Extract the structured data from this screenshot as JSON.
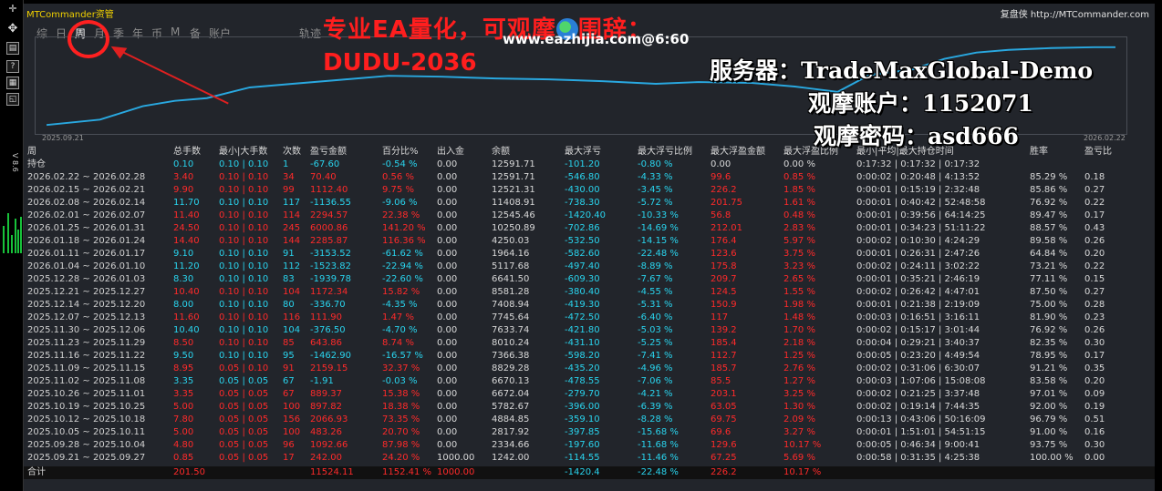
{
  "window": {
    "title": "MTCommander资管",
    "brand": "复盘侠 http://MTCommander.com"
  },
  "toolbar_icons": [
    "move-icon",
    "document-icon",
    "help-icon",
    "grid-icon",
    "window-icon"
  ],
  "side_label": "V 8.6",
  "tabs": [
    "综",
    "日",
    "周",
    "月",
    "季",
    "年",
    "币",
    "M",
    "备",
    "账户"
  ],
  "active_tab": "周",
  "track_tab": "轨迹",
  "chart": {
    "start_date": "2025.09.21",
    "end_date": "2026.02.22",
    "line_color": "#29a8e0"
  },
  "overlay": {
    "title": "专业EA量化，可观摩",
    "title_suffix": "围辞：",
    "code": "DUDU-2036",
    "site": "www.eazhijia.com@6:60",
    "server": "服务器：TradeMaxGlobal-Demo",
    "account": "观摩账户：1152071",
    "password": "观摩密码：asd666"
  },
  "headers": [
    "周",
    "总手数",
    "最小|大手数",
    "次数",
    "盈亏金额",
    "百分比%",
    "出入金",
    "余额",
    "最大浮亏",
    "最大浮亏比例",
    "最大浮盈金额",
    "最大浮盈比例",
    "最小|平均|最大持仓时间",
    "胜率",
    "盈亏比"
  ],
  "holding": {
    "period": "持仓",
    "lots": "0.10",
    "minmax": "0.10 | 0.10",
    "count": "1",
    "pnl": "-67.60",
    "pct": "-0.54 %",
    "io": "0.00",
    "balance": "12591.71",
    "maxdd": "-101.20",
    "maxdd_pct": "-0.80 %",
    "maxfp": "0.00",
    "maxfp_pct": "0.00 %",
    "time": "0:17:32 | 0:17:32 | 0:17:32",
    "winrate": "",
    "pf": ""
  },
  "rows": [
    [
      "2026.02.22 ~ 2026.02.28",
      "3.40",
      "0.10 | 0.10",
      "34",
      "70.40",
      "0.56 %",
      "0.00",
      "12591.71",
      "-546.80",
      "-4.33 %",
      "99.6",
      "0.85 %",
      "0:00:02 | 0:20:48 | 4:13:52",
      "85.29 %",
      "0.18"
    ],
    [
      "2026.02.15 ~ 2026.02.21",
      "9.90",
      "0.10 | 0.10",
      "99",
      "1112.40",
      "9.75 %",
      "0.00",
      "12521.31",
      "-430.00",
      "-3.45 %",
      "226.2",
      "1.85 %",
      "0:00:01 | 0:15:19 | 2:32:48",
      "85.86 %",
      "0.27"
    ],
    [
      "2026.02.08 ~ 2026.02.14",
      "11.70",
      "0.10 | 0.10",
      "117",
      "-1136.55",
      "-9.06 %",
      "0.00",
      "11408.91",
      "-738.30",
      "-5.72 %",
      "201.75",
      "1.61 %",
      "0:00:01 | 0:40:42 | 52:48:58",
      "76.92 %",
      "0.22"
    ],
    [
      "2026.02.01 ~ 2026.02.07",
      "11.40",
      "0.10 | 0.10",
      "114",
      "2294.57",
      "22.38 %",
      "0.00",
      "12545.46",
      "-1420.40",
      "-10.33 %",
      "56.8",
      "0.48 %",
      "0:00:01 | 0:39:56 | 64:14:25",
      "89.47 %",
      "0.17"
    ],
    [
      "2026.01.25 ~ 2026.01.31",
      "24.50",
      "0.10 | 0.10",
      "245",
      "6000.86",
      "141.20 %",
      "0.00",
      "10250.89",
      "-702.86",
      "-14.69 %",
      "212.01",
      "2.83 %",
      "0:00:01 | 0:34:23 | 51:11:22",
      "88.57 %",
      "0.43"
    ],
    [
      "2026.01.18 ~ 2026.01.24",
      "14.40",
      "0.10 | 0.10",
      "144",
      "2285.87",
      "116.36 %",
      "0.00",
      "4250.03",
      "-532.50",
      "-14.15 %",
      "176.4",
      "5.97 %",
      "0:00:02 | 0:10:30 | 4:24:29",
      "89.58 %",
      "0.26"
    ],
    [
      "2026.01.11 ~ 2026.01.17",
      "9.10",
      "0.10 | 0.10",
      "91",
      "-3153.52",
      "-61.62 %",
      "0.00",
      "1964.16",
      "-582.60",
      "-22.48 %",
      "123.6",
      "3.75 %",
      "0:00:01 | 0:26:31 | 2:47:26",
      "64.84 %",
      "0.20"
    ],
    [
      "2026.01.04 ~ 2026.01.10",
      "11.20",
      "0.10 | 0.10",
      "112",
      "-1523.82",
      "-22.94 %",
      "0.00",
      "5117.68",
      "-497.40",
      "-8.89 %",
      "175.8",
      "3.23 %",
      "0:00:02 | 0:24:11 | 3:02:22",
      "73.21 %",
      "0.22"
    ],
    [
      "2025.12.28 ~ 2026.01.03",
      "8.30",
      "0.10 | 0.10",
      "83",
      "-1939.78",
      "-22.60 %",
      "0.00",
      "6641.50",
      "-609.30",
      "-7.67 %",
      "209.7",
      "2.65 %",
      "0:00:01 | 0:35:21 | 2:46:19",
      "77.11 %",
      "0.15"
    ],
    [
      "2025.12.21 ~ 2025.12.27",
      "10.40",
      "0.10 | 0.10",
      "104",
      "1172.34",
      "15.82 %",
      "0.00",
      "8581.28",
      "-380.40",
      "-4.55 %",
      "124.5",
      "1.55 %",
      "0:00:02 | 0:26:42 | 4:47:01",
      "87.50 %",
      "0.27"
    ],
    [
      "2025.12.14 ~ 2025.12.20",
      "8.00",
      "0.10 | 0.10",
      "80",
      "-336.70",
      "-4.35 %",
      "0.00",
      "7408.94",
      "-419.30",
      "-5.31 %",
      "150.9",
      "1.98 %",
      "0:00:01 | 0:21:38 | 2:19:09",
      "75.00 %",
      "0.28"
    ],
    [
      "2025.12.07 ~ 2025.12.13",
      "11.60",
      "0.10 | 0.10",
      "116",
      "111.90",
      "1.47 %",
      "0.00",
      "7745.64",
      "-472.50",
      "-6.40 %",
      "117",
      "1.48 %",
      "0:00:03 | 0:16:51 | 3:16:11",
      "81.90 %",
      "0.23"
    ],
    [
      "2025.11.30 ~ 2025.12.06",
      "10.40",
      "0.10 | 0.10",
      "104",
      "-376.50",
      "-4.70 %",
      "0.00",
      "7633.74",
      "-421.80",
      "-5.03 %",
      "139.2",
      "1.70 %",
      "0:00:02 | 0:15:17 | 3:01:44",
      "76.92 %",
      "0.26"
    ],
    [
      "2025.11.23 ~ 2025.11.29",
      "8.50",
      "0.10 | 0.10",
      "85",
      "643.86",
      "8.74 %",
      "0.00",
      "8010.24",
      "-431.10",
      "-5.25 %",
      "185.4",
      "2.18 %",
      "0:00:04 | 0:29:21 | 3:40:37",
      "82.35 %",
      "0.30"
    ],
    [
      "2025.11.16 ~ 2025.11.22",
      "9.50",
      "0.10 | 0.10",
      "95",
      "-1462.90",
      "-16.57 %",
      "0.00",
      "7366.38",
      "-598.20",
      "-7.41 %",
      "112.7",
      "1.25 %",
      "0:00:05 | 0:23:20 | 4:49:54",
      "78.95 %",
      "0.17"
    ],
    [
      "2025.11.09 ~ 2025.11.15",
      "8.95",
      "0.05 | 0.10",
      "91",
      "2159.15",
      "32.37 %",
      "0.00",
      "8829.28",
      "-435.20",
      "-4.96 %",
      "185.7",
      "2.76 %",
      "0:00:02 | 0:31:06 | 6:30:07",
      "91.21 %",
      "0.35"
    ],
    [
      "2025.11.02 ~ 2025.11.08",
      "3.35",
      "0.05 | 0.05",
      "67",
      "-1.91",
      "-0.03 %",
      "0.00",
      "6670.13",
      "-478.55",
      "-7.06 %",
      "85.5",
      "1.27 %",
      "0:00:03 | 1:07:06 | 15:08:08",
      "83.58 %",
      "0.20"
    ],
    [
      "2025.10.26 ~ 2025.11.01",
      "3.35",
      "0.05 | 0.05",
      "67",
      "889.37",
      "15.38 %",
      "0.00",
      "6672.04",
      "-279.70",
      "-4.21 %",
      "203.1",
      "3.25 %",
      "0:00:02 | 0:21:25 | 3:37:48",
      "97.01 %",
      "0.09"
    ],
    [
      "2025.10.19 ~ 2025.10.25",
      "5.00",
      "0.05 | 0.05",
      "100",
      "897.82",
      "18.38 %",
      "0.00",
      "5782.67",
      "-396.00",
      "-6.39 %",
      "63.05",
      "1.30 %",
      "0:00:02 | 0:19:14 | 7:44:35",
      "92.00 %",
      "0.19"
    ],
    [
      "2025.10.12 ~ 2025.10.18",
      "7.80",
      "0.05 | 0.05",
      "156",
      "2066.93",
      "73.35 %",
      "0.00",
      "4884.85",
      "-359.10",
      "-8.28 %",
      "69.75",
      "2.09 %",
      "0:00:13 | 0:43:06 | 50:16:09",
      "96.79 %",
      "0.51"
    ],
    [
      "2025.10.05 ~ 2025.10.11",
      "5.00",
      "0.05 | 0.05",
      "100",
      "483.26",
      "20.70 %",
      "0.00",
      "2817.92",
      "-397.85",
      "-15.68 %",
      "69.6",
      "3.27 %",
      "0:00:01 | 1:51:01 | 54:51:15",
      "91.00 %",
      "0.16"
    ],
    [
      "2025.09.28 ~ 2025.10.04",
      "4.80",
      "0.05 | 0.05",
      "96",
      "1092.66",
      "87.98 %",
      "0.00",
      "2334.66",
      "-197.60",
      "-11.68 %",
      "129.6",
      "10.17 %",
      "0:00:05 | 0:46:34 | 9:00:41",
      "93.75 %",
      "0.30"
    ],
    [
      "2025.09.21 ~ 2025.09.27",
      "0.85",
      "0.05 | 0.05",
      "17",
      "242.00",
      "24.20 %",
      "1000.00",
      "1242.00",
      "-114.55",
      "-11.46 %",
      "67.25",
      "5.69 %",
      "0:00:58 | 0:31:35 | 4:25:38",
      "100.00 %",
      "0.00"
    ]
  ],
  "total": {
    "label": "合计",
    "lots": "201.50",
    "pnl": "11524.11",
    "pct": "1152.41 %",
    "io": "1000.00",
    "maxdd": "-1420.4",
    "maxdd_pct": "-22.48 %",
    "maxfp": "226.2",
    "maxfp_pct": "10.17 %"
  },
  "equity_curve": [
    [
      0.0,
      0.06
    ],
    [
      0.05,
      0.12
    ],
    [
      0.09,
      0.27
    ],
    [
      0.12,
      0.33
    ],
    [
      0.15,
      0.36
    ],
    [
      0.19,
      0.48
    ],
    [
      0.23,
      0.52
    ],
    [
      0.27,
      0.56
    ],
    [
      0.32,
      0.61
    ],
    [
      0.37,
      0.6
    ],
    [
      0.42,
      0.58
    ],
    [
      0.47,
      0.57
    ],
    [
      0.52,
      0.55
    ],
    [
      0.57,
      0.52
    ],
    [
      0.61,
      0.54
    ],
    [
      0.66,
      0.53
    ],
    [
      0.7,
      0.49
    ],
    [
      0.74,
      0.43
    ],
    [
      0.77,
      0.62
    ],
    [
      0.81,
      0.68
    ],
    [
      0.84,
      0.8
    ],
    [
      0.87,
      0.87
    ],
    [
      0.9,
      0.9
    ],
    [
      0.94,
      0.92
    ],
    [
      0.98,
      0.93
    ],
    [
      1.0,
      0.93
    ]
  ]
}
